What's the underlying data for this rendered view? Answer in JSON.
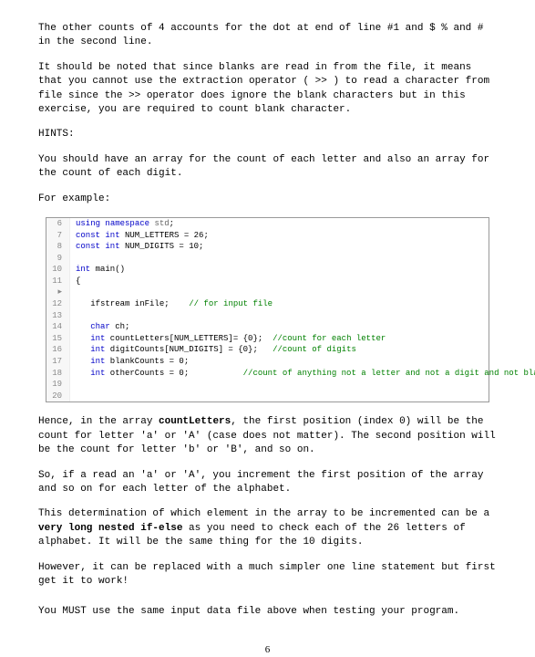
{
  "paragraphs": {
    "p1": "The other counts of 4 accounts for the dot at end of line #1 and $ % and # in the second line.",
    "p2": "It should be noted that since blanks are read in from the file, it means that you cannot use the extraction operator ( >> ) to read a character from file since the >> operator does ignore the blank characters but in this exercise, you are required to count blank character.",
    "hints": "HINTS:",
    "p3": "You should have an array for the count of each letter and also an array for the count of each digit.",
    "p4": "For example:",
    "p5a": "Hence, in the array ",
    "p5b": "countLetters",
    "p5c": ", the first position (index 0) will be the count for letter 'a' or 'A' (case does not matter). The second position will be the count for letter 'b' or 'B', and so on.",
    "p6": "So, if a read an 'a' or 'A', you increment the first position of the array and so on for each letter of the alphabet.",
    "p7a": "This determination of which element in the array to be incremented can be a ",
    "p7b": "very long nested if-else",
    "p7c": " as you need to check each of the 26 letters of alphabet. It will be the same thing for the 10 digits.",
    "p8": "However, it can be replaced with a much simpler one line statement but first get it to work!",
    "p9": "You MUST use the same input data file above when testing your program."
  },
  "code": {
    "lines": [
      {
        "n": "6",
        "indent": "",
        "tokens": [
          [
            "kw",
            "using"
          ],
          [
            "",
            " "
          ],
          [
            "kw",
            "namespace"
          ],
          [
            "",
            " "
          ],
          [
            "ns",
            "std"
          ],
          [
            "",
            ";"
          ]
        ]
      },
      {
        "n": "7",
        "indent": "",
        "tokens": [
          [
            "kw",
            "const int"
          ],
          [
            "",
            " NUM_LETTERS = "
          ],
          [
            "num",
            "26"
          ],
          [
            "",
            ";"
          ]
        ]
      },
      {
        "n": "8",
        "indent": "",
        "tokens": [
          [
            "kw",
            "const int"
          ],
          [
            "",
            " NUM_DIGITS = "
          ],
          [
            "num",
            "10"
          ],
          [
            "",
            ";"
          ]
        ]
      },
      {
        "n": "9",
        "indent": "",
        "tokens": []
      },
      {
        "n": "10",
        "indent": "",
        "tokens": [
          [
            "kw",
            "int"
          ],
          [
            "",
            " main()"
          ]
        ]
      },
      {
        "n": "11 ▸",
        "indent": "",
        "tokens": [
          [
            "",
            "{"
          ]
        ]
      },
      {
        "n": "12",
        "indent": "   ",
        "tokens": [
          [
            "",
            "ifstream inFile;    "
          ],
          [
            "cmt",
            "// for input file"
          ]
        ]
      },
      {
        "n": "13",
        "indent": "",
        "tokens": []
      },
      {
        "n": "14",
        "indent": "   ",
        "tokens": [
          [
            "kw",
            "char"
          ],
          [
            "",
            " ch;"
          ]
        ]
      },
      {
        "n": "15",
        "indent": "   ",
        "tokens": [
          [
            "kw",
            "int"
          ],
          [
            "",
            " countLetters[NUM_LETTERS]= {"
          ],
          [
            "num",
            "0"
          ],
          [
            "",
            "};  "
          ],
          [
            "cmt",
            "//count for each letter"
          ]
        ]
      },
      {
        "n": "16",
        "indent": "   ",
        "tokens": [
          [
            "kw",
            "int"
          ],
          [
            "",
            " digitCounts[NUM_DIGITS] = {"
          ],
          [
            "num",
            "0"
          ],
          [
            "",
            "};   "
          ],
          [
            "cmt",
            "//count of digits"
          ]
        ]
      },
      {
        "n": "17",
        "indent": "   ",
        "tokens": [
          [
            "kw",
            "int"
          ],
          [
            "",
            " blankCounts = "
          ],
          [
            "num",
            "0"
          ],
          [
            "",
            ";"
          ]
        ]
      },
      {
        "n": "18",
        "indent": "   ",
        "tokens": [
          [
            "kw",
            "int"
          ],
          [
            "",
            " otherCounts = "
          ],
          [
            "num",
            "0"
          ],
          [
            "",
            ";           "
          ],
          [
            "cmt",
            "//count of anything not a letter and not a digit and not blank"
          ]
        ]
      },
      {
        "n": "19",
        "indent": "",
        "tokens": []
      },
      {
        "n": "20",
        "indent": "",
        "tokens": []
      }
    ]
  },
  "page_number": "6"
}
